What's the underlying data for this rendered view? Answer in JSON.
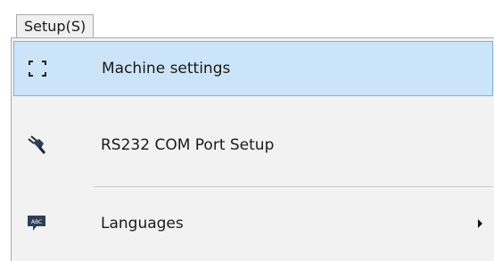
{
  "menu": {
    "title": "Setup(S)"
  },
  "dropdown": {
    "items": [
      {
        "label": "Machine settings",
        "icon": "fullscreen-corners-icon",
        "highlighted": true,
        "submenu": false
      },
      {
        "label": "RS232 COM Port Setup",
        "icon": "plug-icon",
        "highlighted": false,
        "submenu": false
      },
      {
        "label": "Languages",
        "icon": "abc-speech-icon",
        "highlighted": false,
        "submenu": true
      }
    ]
  },
  "colors": {
    "highlight_bg": "#cce4f7",
    "highlight_border": "#79b0e8",
    "menu_bg": "#f2f2f2"
  }
}
